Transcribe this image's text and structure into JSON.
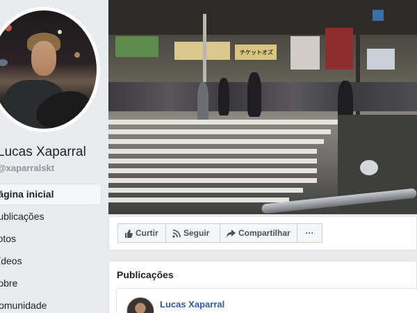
{
  "profile": {
    "name": "Lucas Xaparral",
    "handle": "@xaparralskt"
  },
  "nav": {
    "items": [
      {
        "label": "Página inicial",
        "active": true
      },
      {
        "label": "Publicações",
        "active": false
      },
      {
        "label": "Fotos",
        "active": false
      },
      {
        "label": "Vídeos",
        "active": false
      },
      {
        "label": "Sobre",
        "active": false
      },
      {
        "label": "Comunidade",
        "active": false
      }
    ]
  },
  "cover": {
    "sign_1": "チケットオズ"
  },
  "actions": {
    "like_label": "Curtir",
    "follow_label": "Seguir",
    "share_label": "Compartilhar",
    "more_label": "···"
  },
  "posts": {
    "title": "Publicações",
    "first_author": "Lucas Xaparral"
  },
  "colors": {
    "background": "#e9ebee",
    "link": "#365899",
    "text": "#1d2129",
    "muted": "#90949c"
  }
}
